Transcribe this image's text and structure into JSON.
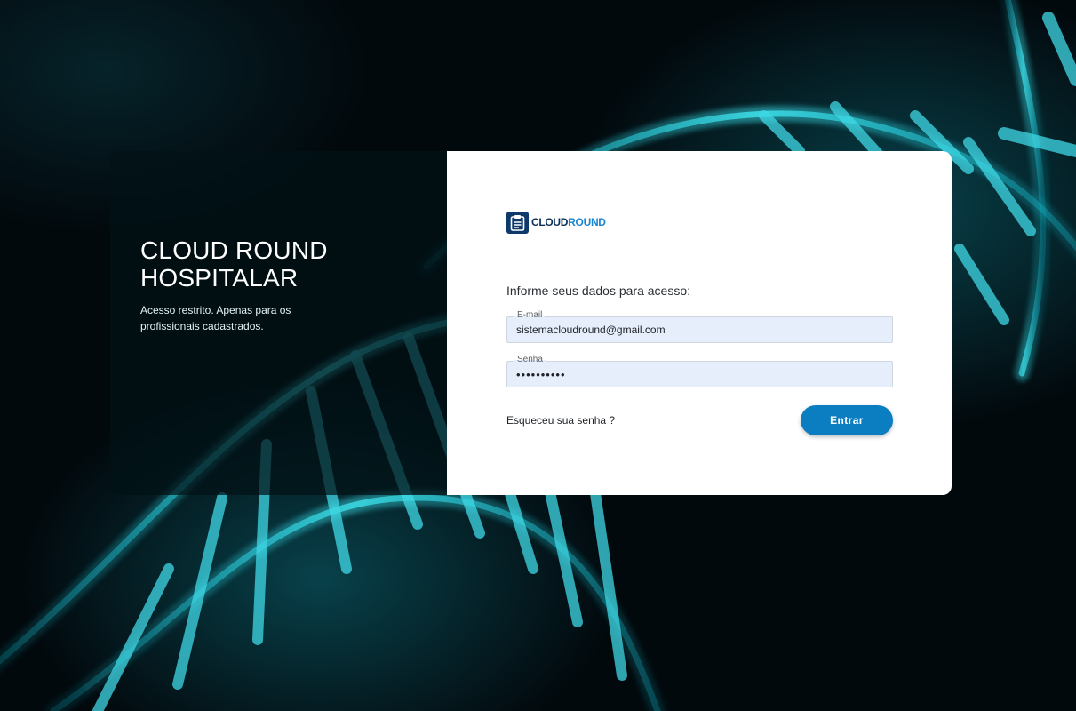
{
  "hero": {
    "title": "CLOUD ROUND HOSPITALAR",
    "subtitle": "Acesso restrito. Apenas para os profissionais cadastrados."
  },
  "logo": {
    "word_cloud": "CLOUD",
    "word_round": "ROUND",
    "icon": "clipboard-icon"
  },
  "form": {
    "prompt": "Informe seus dados para acesso:",
    "email": {
      "label": "E-mail",
      "value": "sistemacloudround@gmail.com"
    },
    "password": {
      "label": "Senha",
      "value": "••••••••••"
    },
    "forgot_link": "Esqueceu sua senha ?",
    "submit_label": "Entrar"
  },
  "colors": {
    "accent": "#0b7dc1",
    "logo_dark": "#0d2f56",
    "logo_light": "#1a86d1",
    "input_bg": "#e6eefc",
    "background": "#02090d"
  },
  "background_image": "dna-helix"
}
